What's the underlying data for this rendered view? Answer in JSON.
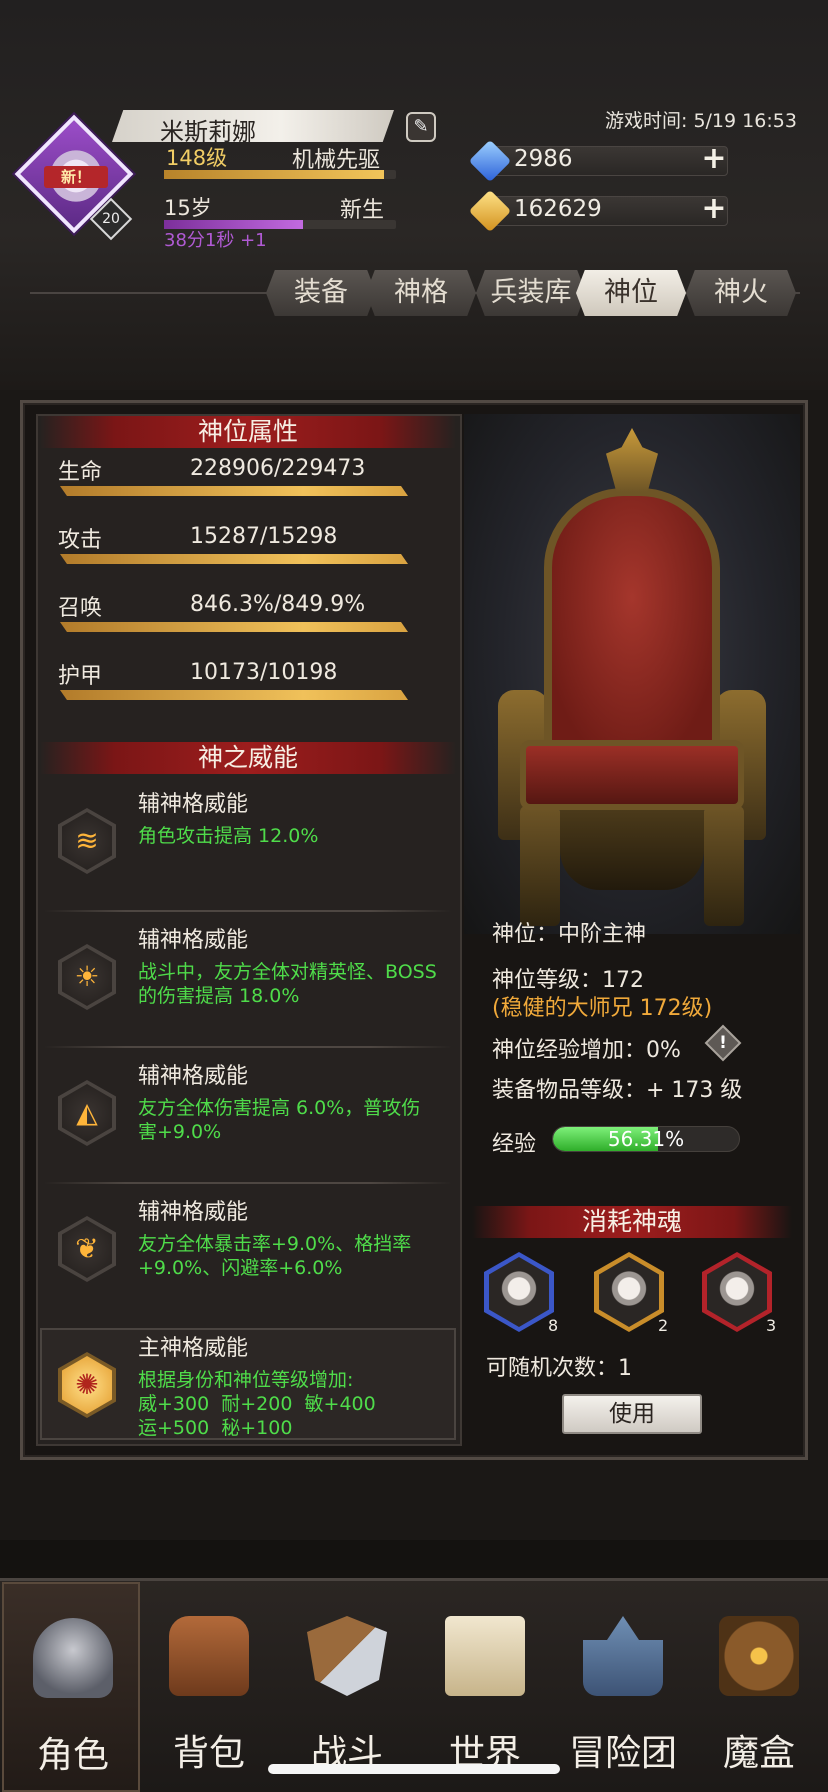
{
  "player": {
    "name": "米斯莉娜",
    "avatar_badge": "新！",
    "avatar_level": "20",
    "level": "148级",
    "class": "机械先驱",
    "age": "15岁",
    "status": "新生",
    "timer": "38分1秒 +1",
    "level_progress": 0.95,
    "age_progress": 0.6
  },
  "game_time": "游戏时间: 5/19 16:53",
  "currency": {
    "diamonds": "2986",
    "gold": "162629"
  },
  "tabs": [
    {
      "label": "装备",
      "active": false
    },
    {
      "label": "神格",
      "active": false
    },
    {
      "label": "兵装库",
      "active": false
    },
    {
      "label": "神位",
      "active": true
    },
    {
      "label": "神火",
      "active": false
    }
  ],
  "attributes": {
    "header": "神位属性",
    "stats": [
      {
        "label": "生命",
        "value": "228906/229473"
      },
      {
        "label": "攻击",
        "value": "15287/15298"
      },
      {
        "label": "召唤",
        "value": "846.3%/849.9%"
      },
      {
        "label": "护甲",
        "value": "10173/10198"
      }
    ]
  },
  "powers": {
    "header": "神之威能",
    "items": [
      {
        "title": "辅神格威能",
        "desc": "角色攻击提高 12.0%",
        "icon": "lightning-icon"
      },
      {
        "title": "辅神格威能",
        "desc": "战斗中，友方全体对精英怪、BOSS的伤害提高 18.0%",
        "icon": "sun-icon"
      },
      {
        "title": "辅神格威能",
        "desc": "友方全体伤害提高 6.0%，普攻伤害+9.0%",
        "icon": "rune-icon"
      },
      {
        "title": "辅神格威能",
        "desc": "友方全体暴击率+9.0%、格挡率+9.0%、闪避率+6.0%",
        "icon": "wing-icon"
      }
    ],
    "main": {
      "title": "主神格威能",
      "line1": "根据身份和神位等级增加:",
      "line2": "威+300  耐+200  敏+400",
      "line3": "运+500  秘+100",
      "icon": "flower-emblem-icon"
    }
  },
  "divine_position": {
    "rank": "神位：中阶主神",
    "level": "神位等级：172",
    "mentor": "(稳健的大师兄 172级)",
    "exp_bonus": "神位经验增加：0%",
    "equip_level": "装备物品等级：+ 173 级",
    "exp_label": "经验",
    "exp_percent": "56.31%",
    "exp_fraction": 0.5631
  },
  "souls": {
    "header": "消耗神魂",
    "items": [
      {
        "count": "8",
        "tier": "blue"
      },
      {
        "count": "2",
        "tier": "gold"
      },
      {
        "count": "3",
        "tier": "red"
      }
    ],
    "reroll_text": "可随机次数：1",
    "use_label": "使用"
  },
  "nav": [
    {
      "label": "角色",
      "icon": "helmet-icon",
      "active": true
    },
    {
      "label": "背包",
      "icon": "backpack-icon",
      "active": false
    },
    {
      "label": "战斗",
      "icon": "sword-shield-icon",
      "active": false
    },
    {
      "label": "世界",
      "icon": "scroll-map-icon",
      "active": false
    },
    {
      "label": "冒险团",
      "icon": "castle-icon",
      "active": false
    },
    {
      "label": "魔盒",
      "icon": "magic-box-icon",
      "active": false
    }
  ],
  "colors": {
    "accent_red": "#9d1d1d",
    "gold_bar": "#f0c15a",
    "desc_green": "#4fdc4a",
    "mentor_orange": "#f0a93a",
    "exp_green": "#2fae2a"
  }
}
